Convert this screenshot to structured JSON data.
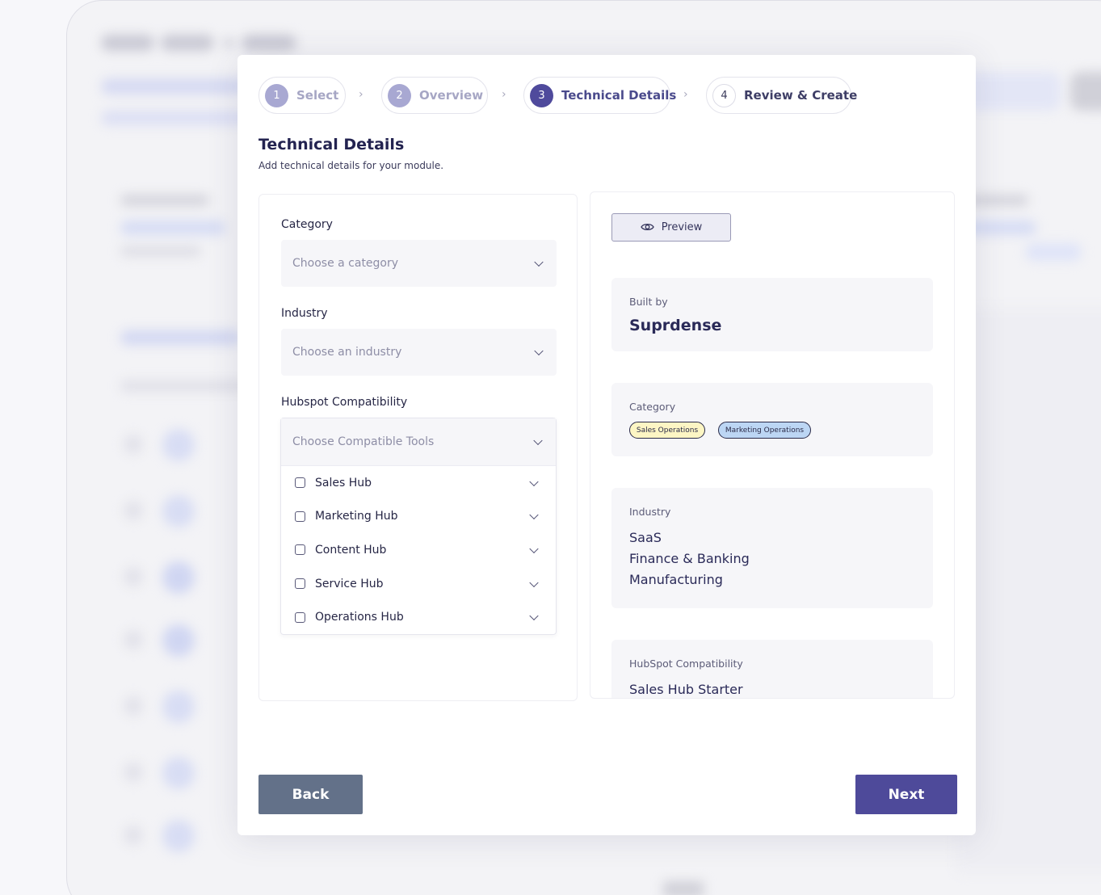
{
  "stepper": {
    "steps": [
      {
        "number": "1",
        "label": "Select",
        "state": "done"
      },
      {
        "number": "2",
        "label": "Overview",
        "state": "done"
      },
      {
        "number": "3",
        "label": "Technical Details",
        "state": "active"
      },
      {
        "number": "4",
        "label": "Review & Create",
        "state": "upcoming"
      }
    ],
    "separator": "›"
  },
  "header": {
    "title": "Technical Details",
    "subtitle": "Add technical details for your module."
  },
  "form": {
    "category": {
      "label": "Category",
      "placeholder": "Choose a category"
    },
    "industry": {
      "label": "Industry",
      "placeholder": "Choose an industry"
    },
    "compatibility": {
      "label": "Hubspot Compatibility",
      "placeholder": "Choose Compatible Tools",
      "options": [
        {
          "label": "Sales Hub",
          "checked": false
        },
        {
          "label": "Marketing Hub",
          "checked": false
        },
        {
          "label": "Content Hub",
          "checked": false
        },
        {
          "label": "Service Hub",
          "checked": false
        },
        {
          "label": "Operations Hub",
          "checked": false
        }
      ]
    }
  },
  "preview": {
    "button_label": "Preview",
    "built_by": {
      "label": "Built by",
      "value": "Suprdense"
    },
    "category": {
      "label": "Category",
      "tags": [
        {
          "label": "Sales Operations",
          "color": "#fdf6c4"
        },
        {
          "label": "Marketing Operations",
          "color": "#bcd6f4"
        }
      ]
    },
    "industry": {
      "label": "Industry",
      "values": [
        "SaaS",
        "Finance & Banking",
        "Manufacturing"
      ]
    },
    "compatibility": {
      "label": "HubSpot Compatibility",
      "value": "Sales Hub Starter"
    }
  },
  "footer": {
    "back_label": "Back",
    "next_label": "Next"
  },
  "colors": {
    "primary": "#4e4a9a",
    "secondary": "#637189",
    "step_done": "#a8a8d2"
  }
}
